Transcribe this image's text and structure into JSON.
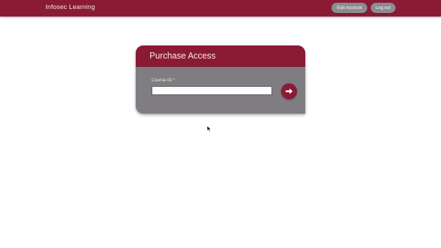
{
  "header": {
    "brand": "Infosec Learning",
    "nav": {
      "edit_account": "Edit Account",
      "log_out": "Log out"
    }
  },
  "card": {
    "title": "Purchase Access",
    "field": {
      "label": "Course ID *",
      "value": "",
      "placeholder": ""
    },
    "submit_icon": "arrow-right-icon"
  },
  "colors": {
    "brand": "#8b1a35",
    "card_body": "#7f7d81",
    "nav_button": "#8d8b8e"
  }
}
